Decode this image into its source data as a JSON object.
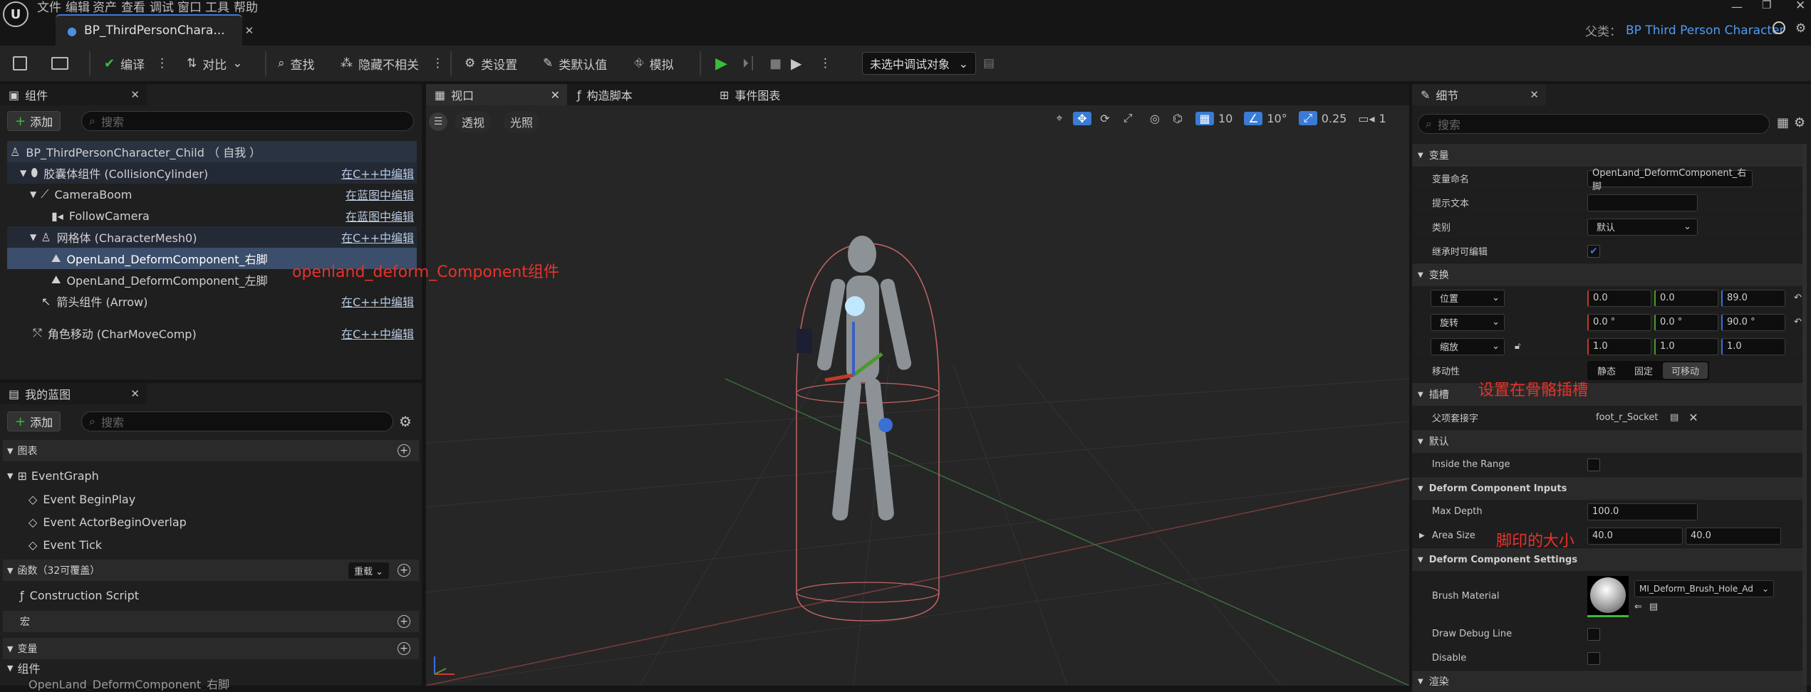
{
  "menu": [
    "文件",
    "编辑",
    "资产",
    "查看",
    "调试",
    "窗口",
    "工具",
    "帮助"
  ],
  "tab_title": "BP_ThirdPersonChara...",
  "parent_label": "父类：",
  "parent_value": "BP Third Person Character",
  "toolbar": {
    "compile": "编译",
    "diff": "对比",
    "find": "查找",
    "hide_unrelated": "隐藏不相关",
    "class_settings": "类设置",
    "class_defaults": "类默认值",
    "simulate": "模拟",
    "debug_target": "未选中调试对象"
  },
  "components": {
    "title": "组件",
    "add": "添加",
    "search_placeholder": "搜索",
    "items": [
      {
        "label": "BP_ThirdPersonCharacter_Child （ 自我 ）",
        "link": ""
      },
      {
        "label": "胶囊体组件 (CollisionCylinder)",
        "link": "在C++中编辑"
      },
      {
        "label": "CameraBoom",
        "link": "在蓝图中编辑"
      },
      {
        "label": "FollowCamera",
        "link": "在蓝图中编辑"
      },
      {
        "label": "网格体 (CharacterMesh0)",
        "link": "在C++中编辑"
      },
      {
        "label": "OpenLand_DeformComponent_右脚",
        "link": ""
      },
      {
        "label": "OpenLand_DeformComponent_左脚",
        "link": ""
      },
      {
        "label": "箭头组件 (Arrow)",
        "link": "在C++中编辑"
      },
      {
        "label": "角色移动 (CharMoveComp)",
        "link": "在C++中编辑"
      }
    ]
  },
  "annotation_component": "openland_deform_Component组件",
  "my_blueprint": {
    "title": "我的蓝图",
    "add": "添加",
    "search_placeholder": "搜索",
    "graphs": "图表",
    "event_graph": "EventGraph",
    "events": [
      "Event BeginPlay",
      "Event ActorBeginOverlap",
      "Event Tick"
    ],
    "functions": "函数（32可覆盖）",
    "override": "重载",
    "construction": "Construction Script",
    "macros": "宏",
    "variables": "变量",
    "components": "组件",
    "truncated": "OpenLand_DeformComponent_右脚"
  },
  "center_tabs": [
    "视口",
    "构造脚本",
    "事件图表"
  ],
  "viewport": {
    "perspective": "透视",
    "lit": "光照",
    "grid": "10",
    "angle": "10°",
    "scale": "0.25",
    "cam": "1"
  },
  "details": {
    "title": "细节",
    "search_placeholder": "搜索",
    "sec_variable": "变量",
    "var_name_label": "变量命名",
    "var_name": "OpenLand_DeformComponent_右脚",
    "tooltip_label": "提示文本",
    "category_label": "类别",
    "category": "默认",
    "inherit_label": "继承时可编辑",
    "sec_transform": "变换",
    "location": "位置",
    "rotation": "旋转",
    "scale": "缩放",
    "loc": [
      "0.0",
      "0.0",
      "89.0"
    ],
    "rot": [
      "0.0 °",
      "0.0 °",
      "90.0 °"
    ],
    "scl": [
      "1.0",
      "1.0",
      "1.0"
    ],
    "mobility_label": "移动性",
    "mobility": [
      "静态",
      "固定",
      "可移动"
    ],
    "sec_socket": "插槽",
    "parent_socket_label": "父项套接字",
    "parent_socket": "foot_r_Socket",
    "sec_default": "默认",
    "inside_range": "Inside the Range",
    "sec_inputs": "Deform Component Inputs",
    "max_depth_label": "Max Depth",
    "max_depth": "100.0",
    "area_label": "Area Size",
    "area": [
      "40.0",
      "40.0"
    ],
    "sec_settings": "Deform Component Settings",
    "brush_label": "Brush Material",
    "brush": "MI_Deform_Brush_Hole_Ad",
    "debug_label": "Draw Debug Line",
    "disable_label": "Disable",
    "last_sec": "渲染"
  },
  "annot_socket": "设置在骨骼插槽",
  "annot_size": "脚印的大小",
  "colors": {
    "accent": "#3a7bd5",
    "annot": "#e8322a",
    "play": "#3dbb3d"
  }
}
